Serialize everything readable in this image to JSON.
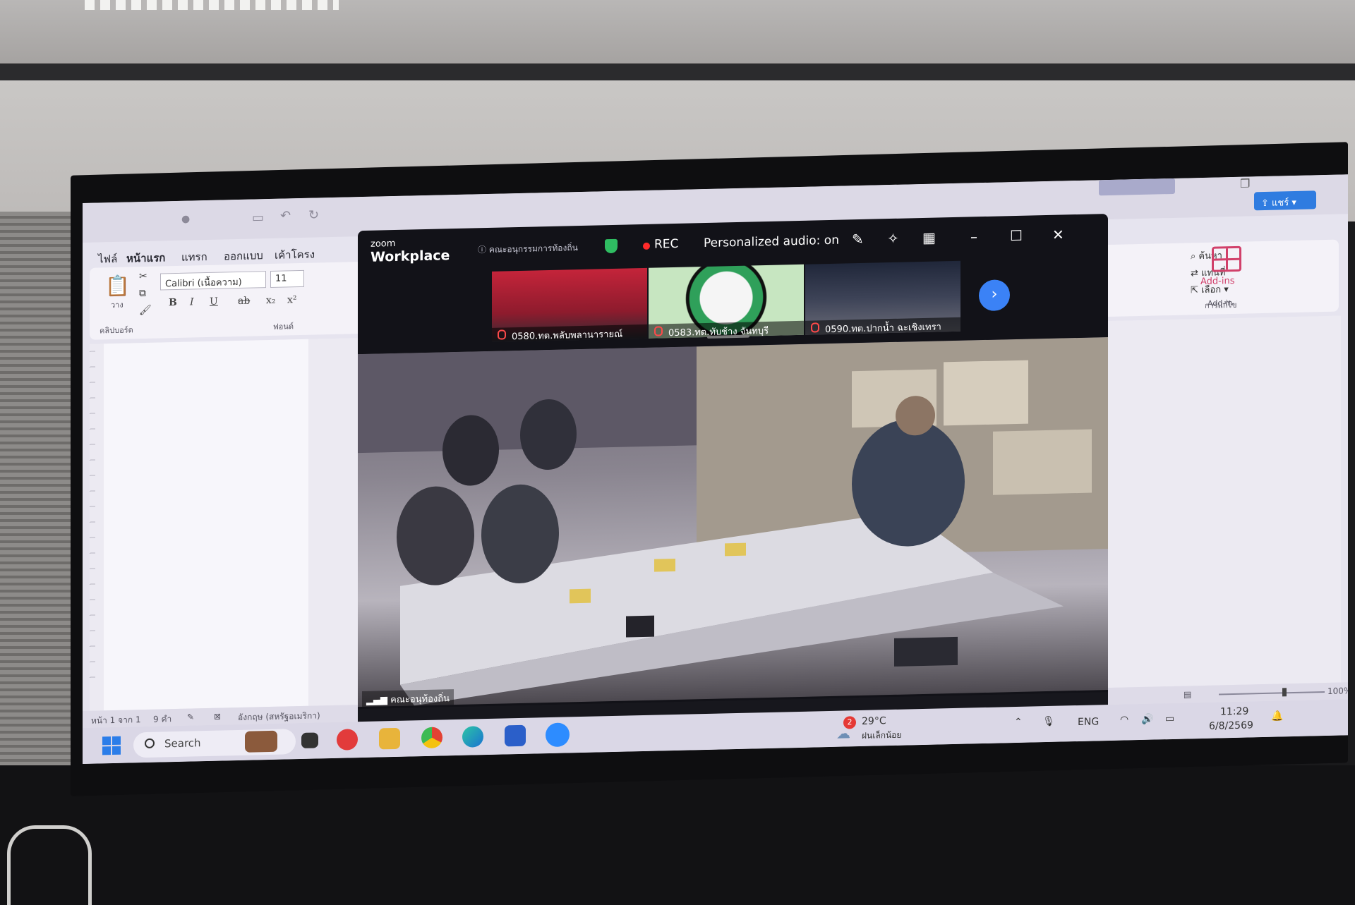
{
  "word": {
    "ribbon_tabs": [
      "ไฟล์",
      "หน้าแรก",
      "แทรก",
      "ออกแบบ",
      "เค้าโครง"
    ],
    "active_tab": "หน้าแรก",
    "font_name": "Calibri (เนื้อความ)",
    "font_size": "11",
    "clipboard_label": "คลิปบอร์ด",
    "paste_label": "วาง",
    "font_group_label": "ฟอนต์",
    "find_label": "ค้นหา",
    "replace_label": "แทนที่",
    "select_label": "เลือก",
    "editing_label": "การแก้ไข",
    "addins_label": "Add-ins",
    "addin_group_label": "Add-in",
    "share_label": "แชร์",
    "status": {
      "page": "หน้า 1 จาก 1",
      "words": "9 คำ",
      "language": "อังกฤษ (สหรัฐอเมริกา)",
      "zoom": "100%"
    }
  },
  "zoom": {
    "brand_small": "zoom",
    "brand_big": "Workplace",
    "meeting_info": "คณะอนุกรรมการท้องถิ่น",
    "rec_label": "REC",
    "audio_status": "Personalized audio: on",
    "participants": [
      {
        "label": "0580.ทต.พลับพลานารายณ์"
      },
      {
        "label": "0583.ทต.ทับช้าง จันทบุรี"
      },
      {
        "label": "0590.ทต.ปากน้ำ ฉะเชิงเทรา"
      }
    ],
    "speaker_label": "คณะอนุท้องถิ่น"
  },
  "taskbar": {
    "search_placeholder": "Search",
    "weather_temp": "29°C",
    "weather_desc": "ฝนเล็กน้อย",
    "weather_badge": "2",
    "language": "ENG",
    "time": "11:29",
    "date": "6/8/2569"
  },
  "colors": {
    "zoom_bg": "#121218",
    "rec_red": "#ff2a2a",
    "accent_blue": "#2b7de9",
    "word_ribbon": "#f4f2f8"
  }
}
